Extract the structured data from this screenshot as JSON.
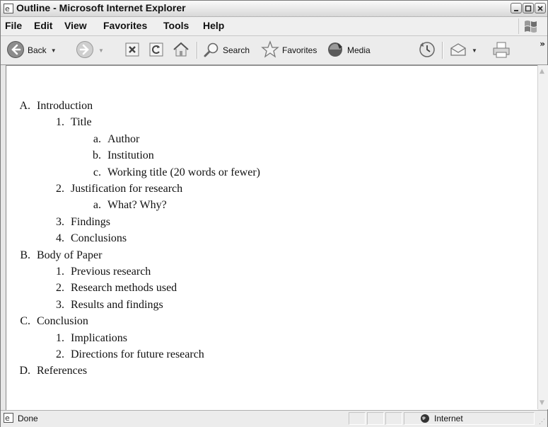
{
  "window": {
    "title": "Outline - Microsoft Internet Explorer"
  },
  "menu": [
    "File",
    "Edit",
    "View",
    "Favorites",
    "Tools",
    "Help"
  ],
  "toolbar": {
    "back": "Back",
    "search": "Search",
    "favorites": "Favorites",
    "media": "Media",
    "overflow": "»"
  },
  "outline": [
    {
      "marker": "A.",
      "text": "Introduction",
      "level": 1
    },
    {
      "marker": "1.",
      "text": "Title",
      "level": 2
    },
    {
      "marker": "a.",
      "text": "Author",
      "level": 3
    },
    {
      "marker": "b.",
      "text": "Institution",
      "level": 3
    },
    {
      "marker": "c.",
      "text": "Working title (20 words or fewer)",
      "level": 3
    },
    {
      "marker": "2.",
      "text": "Justification for research",
      "level": 2
    },
    {
      "marker": "a.",
      "text": "What? Why?",
      "level": 3
    },
    {
      "marker": "3.",
      "text": "Findings",
      "level": 2
    },
    {
      "marker": "4.",
      "text": "Conclusions",
      "level": 2
    },
    {
      "marker": "B.",
      "text": "Body of Paper",
      "level": 1
    },
    {
      "marker": "1.",
      "text": "Previous research",
      "level": 2
    },
    {
      "marker": "2.",
      "text": "Research methods used",
      "level": 2
    },
    {
      "marker": "3.",
      "text": "Results and findings",
      "level": 2
    },
    {
      "marker": "C.",
      "text": "Conclusion",
      "level": 1
    },
    {
      "marker": "1.",
      "text": "Implications",
      "level": 2
    },
    {
      "marker": "2.",
      "text": "Directions for future research",
      "level": 2
    },
    {
      "marker": "D.",
      "text": "References",
      "level": 1
    }
  ],
  "status": {
    "text": "Done",
    "zone": "Internet"
  }
}
